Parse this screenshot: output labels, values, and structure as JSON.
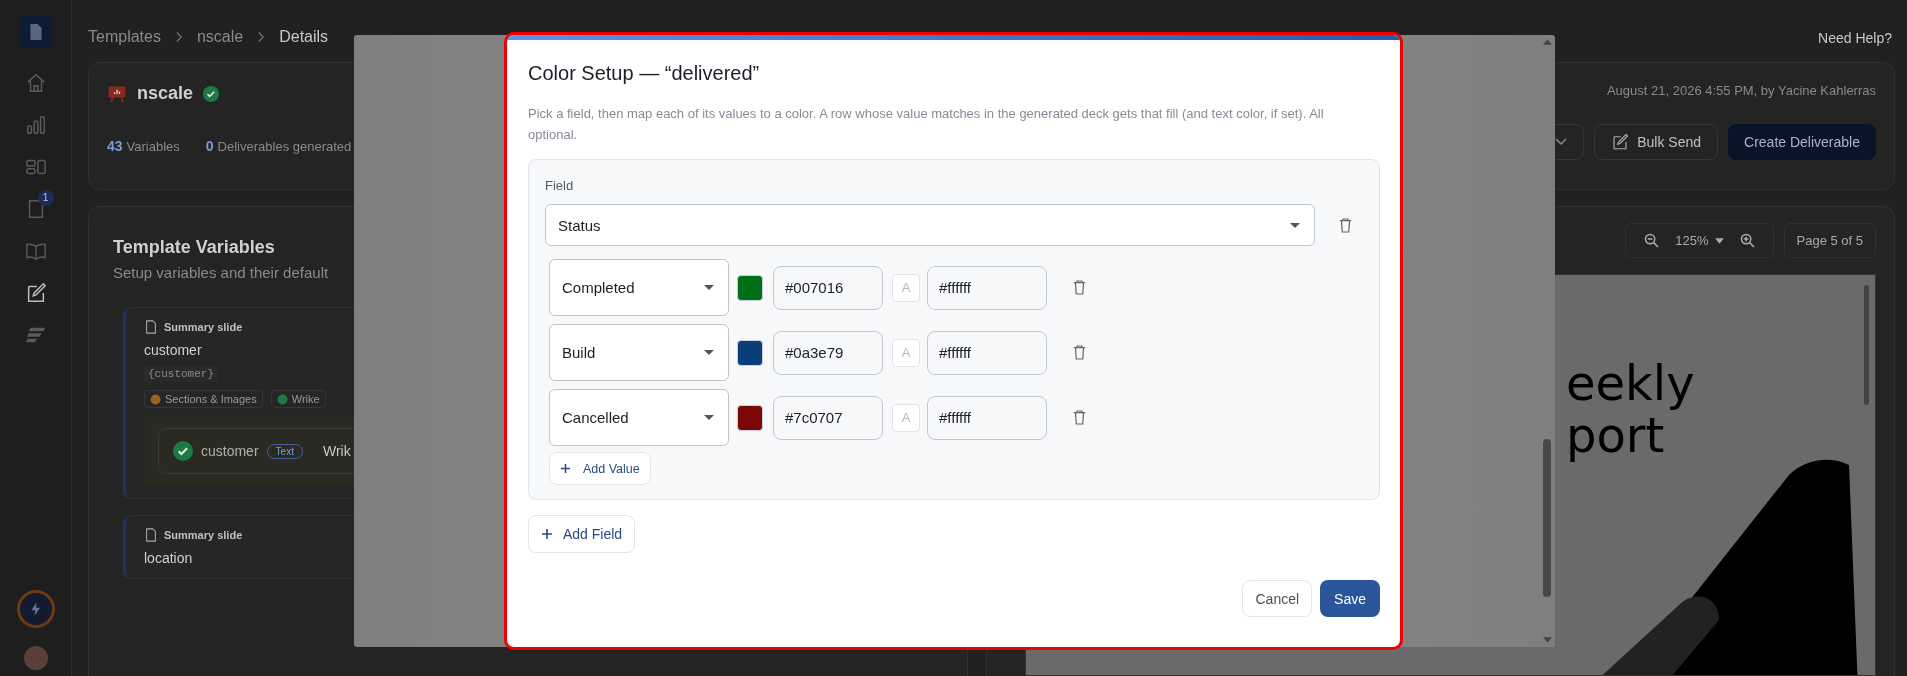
{
  "sidebar": {
    "items": [
      {
        "kind": "home",
        "selected": false
      },
      {
        "kind": "chart",
        "selected": false
      },
      {
        "kind": "layout",
        "selected": false
      },
      {
        "kind": "document",
        "selected": false,
        "badge": "1"
      },
      {
        "kind": "book",
        "selected": false
      },
      {
        "kind": "edit",
        "selected": true
      },
      {
        "kind": "brand",
        "selected": false
      }
    ]
  },
  "breadcrumb": [
    "Templates",
    "nscale",
    "Details"
  ],
  "need_help": "Need Help?",
  "header": {
    "name": "nscale",
    "verified": true,
    "stats": [
      {
        "value": "43",
        "label": "Variables"
      },
      {
        "value": "0",
        "label": "Deliverables generated"
      }
    ],
    "updated": "August 21, 2026 4:55 PM, by Yacine Kahlerras",
    "buttons": [
      {
        "kind": "dropdown"
      },
      {
        "kind": "outline",
        "label": "Bulk Send"
      },
      {
        "kind": "primary",
        "label": "Create Deliverable"
      }
    ]
  },
  "variables": {
    "title": "Template Variables",
    "subtitle": "Setup variables and their default",
    "cards": [
      {
        "section": "Summary slide",
        "name": "customer",
        "token": "{customer}",
        "chips": [
          {
            "kind": "palette",
            "label": "Sections & Images"
          },
          {
            "kind": "check",
            "label": "Wrike"
          }
        ],
        "mapping": {
          "name": "customer",
          "type": "Text",
          "target": "Wrik"
        }
      },
      {
        "section": "Summary slide",
        "name": "location"
      }
    ]
  },
  "preview": {
    "zoom": "125%",
    "page": "Page 5 of 5",
    "slide_lines": [
      "eekly",
      "port"
    ]
  },
  "modal": {
    "title": "Color Setup — “delivered”",
    "description": "Pick a field, then map each of its values to a color. A row whose value matches in the generated deck gets that fill (and text color, if set). All optional.",
    "fields": [
      {
        "label": "Field",
        "value": "Status",
        "add_value": "Add Value",
        "rows": [
          {
            "value": "Completed",
            "color": "#007016",
            "text_glyph": "A",
            "text_color": "#ffffff"
          },
          {
            "value": "Build",
            "color": "#0a3e79",
            "text_glyph": "A",
            "text_color": "#ffffff"
          },
          {
            "value": "Cancelled",
            "color": "#7c0707",
            "text_glyph": "A",
            "text_color": "#ffffff"
          }
        ]
      }
    ],
    "add_field": "Add Field",
    "buttons": [
      {
        "kind": "secondary",
        "label": "Cancel"
      },
      {
        "kind": "primary",
        "label": "Save"
      }
    ]
  }
}
